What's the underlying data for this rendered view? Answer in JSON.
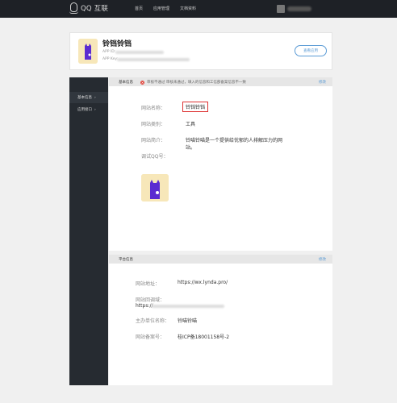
{
  "topnav": {
    "logo_text": "QQ 互联",
    "links": [
      "首页",
      "应用管理",
      "文档资料"
    ]
  },
  "app": {
    "name": "铃铛铃铛",
    "app_id_label": "APP ID:",
    "app_key_label": "APP Key:",
    "manage_button": "查看应用"
  },
  "sidebar": {
    "items": [
      {
        "label": "基本信息",
        "arrow": "›"
      },
      {
        "label": "应用接口",
        "arrow": "›"
      }
    ]
  },
  "basic": {
    "title": "基本信息",
    "warning": "审核不通过 审核未通过，填入的信息和工信部备案信息不一致",
    "edit": "修改",
    "site_name_label": "网站名称：",
    "site_name_value": "铃铛铃铛",
    "site_type_label": "网站类别：",
    "site_type_value": "工具",
    "site_intro_label": "网站简介：",
    "site_intro_value_1": "铃喵铃喵是一个提供给忧郁的人排解压力的网",
    "site_intro_value_2": "站。",
    "debug_qq_label": "调试QQ号："
  },
  "platform": {
    "title": "平台信息",
    "edit": "修改",
    "site_url_label": "网站地址：",
    "site_url_value": "https://wx.lynda.pro/",
    "callback_label": "网站回调域：",
    "callback_value": "https://",
    "owner_label": "主办单位名称：",
    "owner_value": "铃喵铃喵",
    "icp_label": "网站备案号：",
    "icp_value": "桂ICP备18001158号-2"
  },
  "colors": {
    "nav_bg": "#1e2126",
    "sidebar_bg": "#262b31",
    "accent": "#5b9bd5",
    "highlight_border": "#d33",
    "icon_bg": "#f7e7b9",
    "icon_purple": "#5b2bd1"
  },
  "icons": {
    "logo": "qq-penguin-icon",
    "app": "purple-cat-app-icon",
    "warning": "warning-icon"
  }
}
